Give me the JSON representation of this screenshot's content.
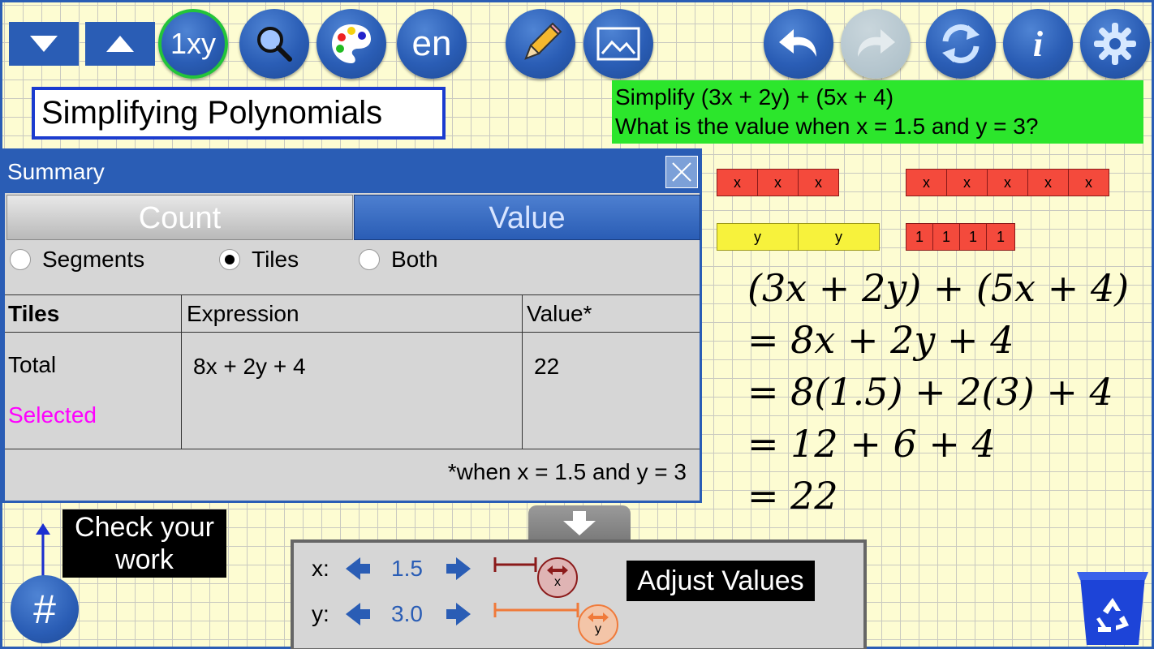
{
  "toolbar": {
    "down_label": "",
    "up_label": "",
    "mode_label": "1xy",
    "lang_label": "en",
    "info_label": "i"
  },
  "title": "Simplifying Polynomials",
  "prompt": {
    "line1": "Simplify (3x + 2y) + (5x + 4)",
    "line2": "What is the value when x = 1.5 and y = 3?"
  },
  "tiles": {
    "x": "x",
    "y": "y",
    "one": "1"
  },
  "summary": {
    "title": "Summary",
    "tabs": [
      "Count",
      "Value"
    ],
    "active_tab": "Value",
    "radios": [
      "Segments",
      "Tiles",
      "Both"
    ],
    "selected_radio": "Tiles",
    "headers": [
      "Tiles",
      "Expression",
      "Value*"
    ],
    "rows": [
      {
        "label": "Total",
        "expression": "8x + 2y + 4",
        "value": "22"
      },
      {
        "label": "Selected",
        "expression": "",
        "value": ""
      }
    ],
    "footnote": "*when x = 1.5 and y = 3",
    "selected_color": "#ff00ff"
  },
  "handwriting": {
    "line1": "(3x + 2y) + (5x + 4)",
    "line2": "= 8x + 2y + 4",
    "line3": "= 8(1.5) + 2(3) + 4",
    "line4": "= 12 + 6 + 4",
    "line5": "= 22"
  },
  "check": {
    "label": "Check your work",
    "button": "#"
  },
  "adjust": {
    "title": "Adjust Values",
    "x_label": "x:",
    "x_value": "1.5",
    "y_label": "y:",
    "y_value": "3.0",
    "x_handle": "x",
    "y_handle": "y",
    "x_color": "#8b1a1a",
    "y_color": "#f07a3a"
  },
  "colors": {
    "accent": "#2a5db5",
    "prompt_bg": "#2ce62c",
    "tile_red": "#f44a3c",
    "tile_yellow": "#f7f23c"
  }
}
